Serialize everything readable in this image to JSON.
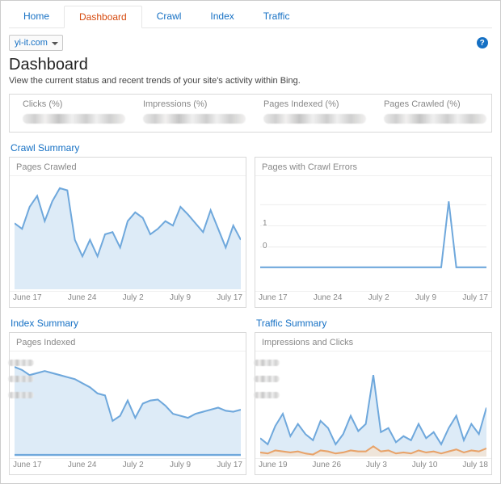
{
  "nav": {
    "tabs": [
      "Home",
      "Dashboard",
      "Crawl",
      "Index",
      "Traffic"
    ],
    "active_index": 1
  },
  "site_selector": {
    "value": "yi-it.com"
  },
  "help_icon_glyph": "?",
  "page_title": "Dashboard",
  "subtitle": "View the current status and recent trends of your site's activity within Bing.",
  "metrics": [
    {
      "label": "Clicks (%)"
    },
    {
      "label": "Impressions (%)"
    },
    {
      "label": "Pages Indexed (%)"
    },
    {
      "label": "Pages Crawled (%)"
    }
  ],
  "sections": {
    "crawl": {
      "title": "Crawl Summary",
      "left": {
        "header": "Pages Crawled"
      },
      "right": {
        "header": "Pages with Crawl Errors"
      }
    },
    "index": {
      "title": "Index Summary",
      "header": "Pages Indexed"
    },
    "traffic": {
      "title": "Traffic Summary",
      "header": "Impressions and Clicks"
    }
  },
  "chart_data": [
    {
      "type": "area",
      "title": "Pages Crawled",
      "x_labels": [
        "June 17",
        "June 24",
        "July 2",
        "July 9",
        "July 17"
      ],
      "series": [
        {
          "name": "Pages Crawled",
          "values": [
            60,
            55,
            75,
            85,
            62,
            80,
            92,
            90,
            45,
            30,
            45,
            30,
            50,
            52,
            38,
            62,
            70,
            65,
            50,
            55,
            62,
            58,
            75,
            68,
            60,
            52,
            72,
            55,
            38,
            58,
            45
          ]
        }
      ]
    },
    {
      "type": "line",
      "title": "Pages with Crawl Errors",
      "x_labels": [
        "June 17",
        "June 24",
        "July 2",
        "July 9",
        "July 17"
      ],
      "y_ticks": [
        0,
        1
      ],
      "series": [
        {
          "name": "Errors",
          "values": [
            0,
            0,
            0,
            0,
            0,
            0,
            0,
            0,
            0,
            0,
            0,
            0,
            0,
            0,
            0,
            0,
            0,
            0,
            0,
            0,
            0,
            0,
            0,
            0,
            0,
            1.5,
            0,
            0,
            0,
            0,
            0
          ]
        }
      ],
      "ylim": [
        -0.5,
        2
      ]
    },
    {
      "type": "area",
      "title": "Pages Indexed",
      "x_labels": [
        "June 17",
        "June 24",
        "July 2",
        "July 9",
        "July 17"
      ],
      "series": [
        {
          "name": "Pages Indexed",
          "values": [
            88,
            85,
            80,
            82,
            84,
            82,
            80,
            78,
            76,
            72,
            68,
            62,
            60,
            35,
            40,
            55,
            38,
            52,
            55,
            56,
            50,
            42,
            40,
            38,
            42,
            44,
            46,
            48,
            45,
            44,
            46
          ]
        }
      ]
    },
    {
      "type": "area",
      "title": "Impressions and Clicks",
      "x_labels": [
        "June 19",
        "June 26",
        "July 3",
        "July 10",
        "July 18"
      ],
      "series": [
        {
          "name": "Impressions",
          "values": [
            18,
            12,
            30,
            42,
            20,
            32,
            22,
            16,
            35,
            28,
            12,
            22,
            40,
            25,
            32,
            80,
            24,
            28,
            14,
            20,
            16,
            32,
            18,
            24,
            12,
            28,
            40,
            16,
            32,
            22,
            48
          ]
        },
        {
          "name": "Clicks",
          "values": [
            4,
            3,
            6,
            5,
            4,
            5,
            3,
            2,
            6,
            5,
            3,
            4,
            6,
            5,
            5,
            10,
            5,
            6,
            3,
            4,
            3,
            6,
            4,
            5,
            3,
            5,
            7,
            4,
            6,
            5,
            8
          ]
        }
      ]
    }
  ]
}
